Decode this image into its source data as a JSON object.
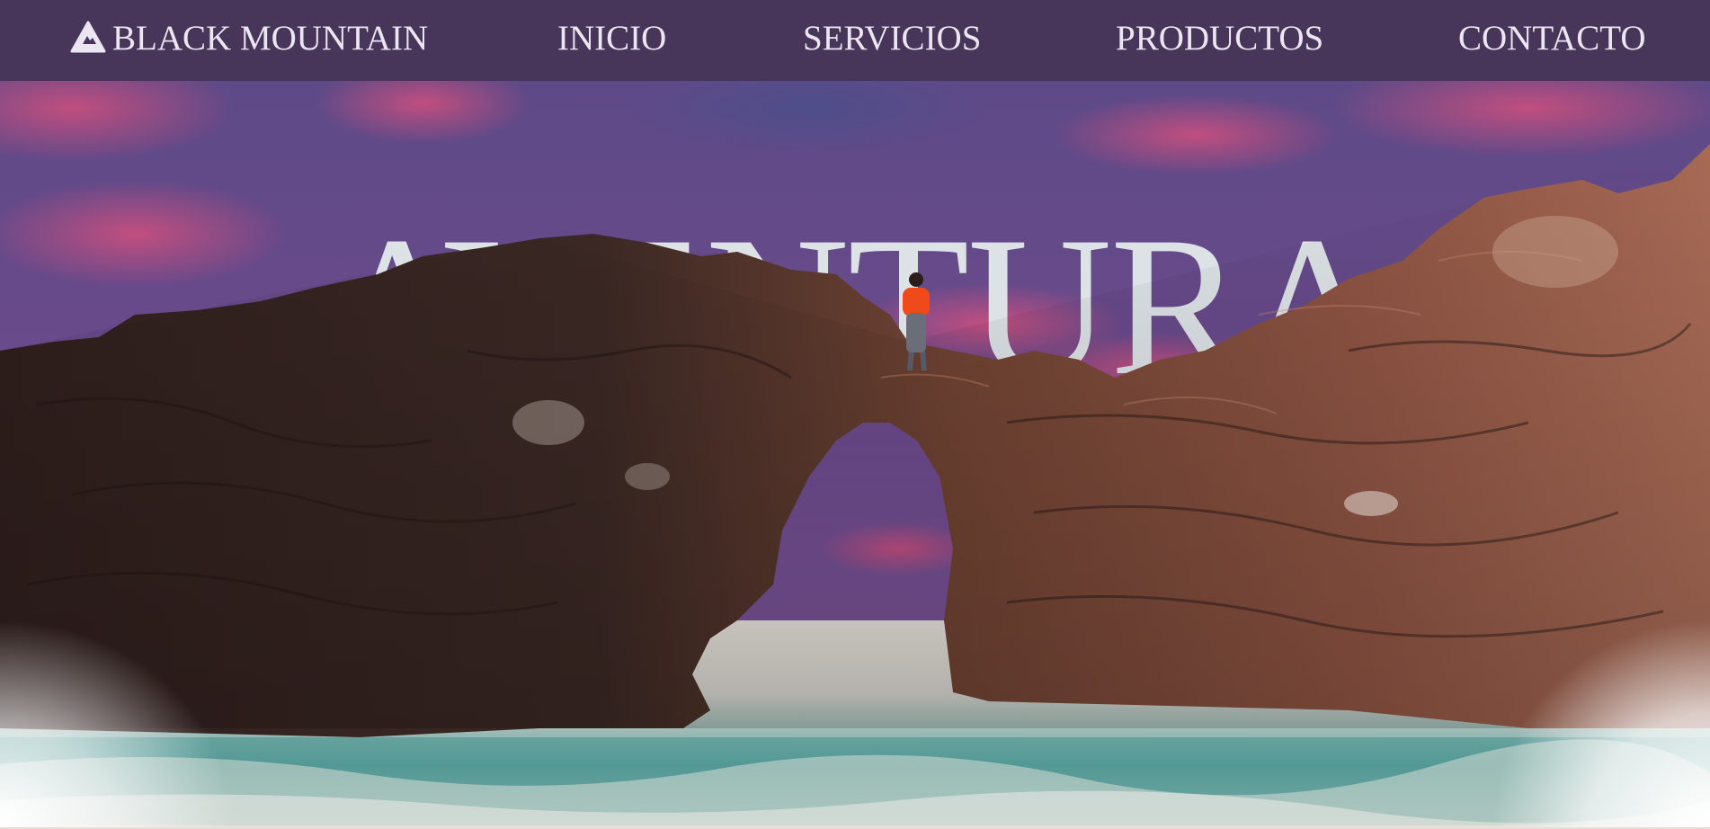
{
  "brand": {
    "name": "BLACK MOUNTAIN",
    "icon": "mountain-icon"
  },
  "nav": {
    "items": [
      {
        "id": "inicio",
        "label": "INICIO"
      },
      {
        "id": "servicios",
        "label": "SERVICIOS"
      },
      {
        "id": "productos",
        "label": "PRODUCTOS"
      },
      {
        "id": "contacto",
        "label": "CONTACTO"
      }
    ]
  },
  "hero": {
    "title": "AVENTURA",
    "image": "sea-arch-rock-with-hiker"
  },
  "colors": {
    "navbar": "#47355a",
    "nav_text": "#ece6f2",
    "title": "#dde2e6",
    "sky_purple": "#5b4a86",
    "sky_pink": "#c7497a",
    "rock_dark": "#2e1e1c",
    "rock_warm": "#8c5040",
    "sea": "#2f8a8a",
    "hiker_jacket": "#f04a1a"
  }
}
